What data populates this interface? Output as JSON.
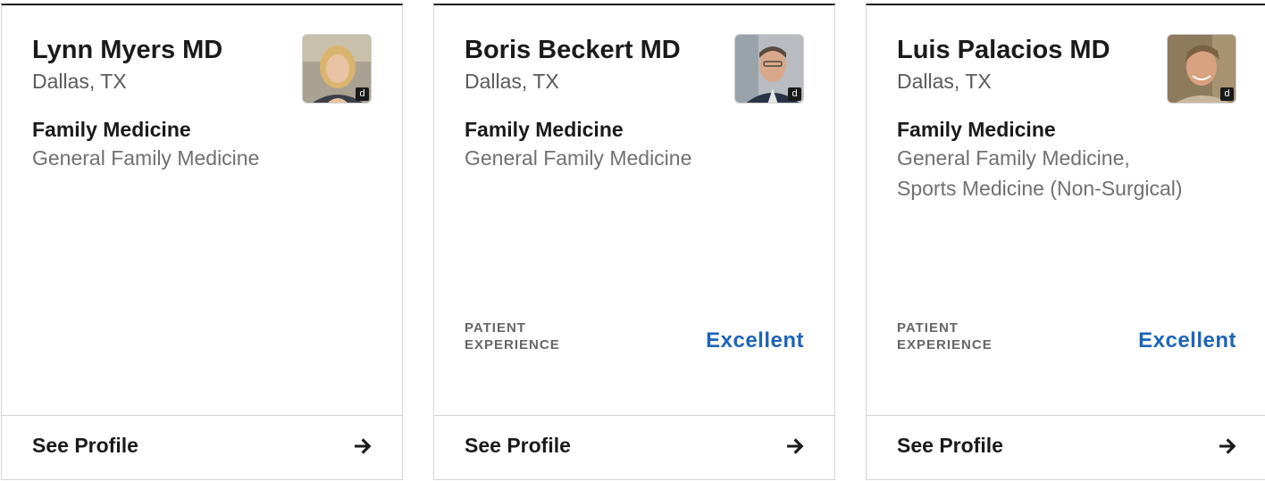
{
  "cards": [
    {
      "name": "Lynn Myers MD",
      "location": "Dallas, TX",
      "specialty": "Family Medicine",
      "subspecialty": "General Family Medicine",
      "rating_label": "",
      "rating_value": "",
      "badge": "d",
      "cta": "See Profile"
    },
    {
      "name": "Boris Beckert MD",
      "location": "Dallas, TX",
      "specialty": "Family Medicine",
      "subspecialty": "General Family Medicine",
      "rating_label": "PATIENT EXPERIENCE",
      "rating_value": "Excellent",
      "badge": "d",
      "cta": "See Profile"
    },
    {
      "name": "Luis Palacios MD",
      "location": "Dallas, TX",
      "specialty": "Family Medicine",
      "subspecialty": "General Family Medicine, Sports Medicine (Non-Surgical)",
      "rating_label": "PATIENT EXPERIENCE",
      "rating_value": "Excellent",
      "badge": "d",
      "cta": "See Profile"
    }
  ],
  "icons": {
    "footer_arrow": "arrow-right-icon",
    "badge": "doximity-badge-icon"
  },
  "colors": {
    "rating_accent": "#1e64b9",
    "heading": "#1a1a1a",
    "muted": "#707070",
    "border": "#d6d6d6"
  }
}
